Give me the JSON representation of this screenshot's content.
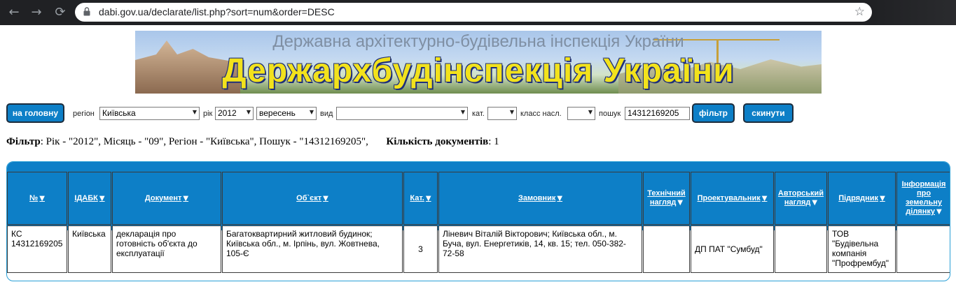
{
  "browser": {
    "url": "dabi.gov.ua/declarate/list.php?sort=num&order=DESC"
  },
  "banner": {
    "subtitle": "Державна архітектурно-будівельна інспекція України",
    "title": "Держархбудінспекція України"
  },
  "filters": {
    "home_label": "на головну",
    "region_label": "регіон",
    "region_value": "Київська",
    "year_label": "рік",
    "year_value": "2012",
    "month_value": "вересень",
    "type_label": "вид",
    "type_value": "",
    "cat_label": "кат.",
    "cat_value": "",
    "class_label": "класс насл.",
    "class_value": "",
    "search_label": "пошук",
    "search_value": "14312169205",
    "filter_button": "фільтр",
    "reset_button": "скинути"
  },
  "summary": {
    "filter_label": "Фільтр",
    "filter_text": ": Рік - \"2012\", Місяць - \"09\", Регіон - \"Київська\", Пошук - \"14312169205\",",
    "count_label": "Кількість документів",
    "count_text": ": 1"
  },
  "table": {
    "headers": [
      "№",
      "ІДАБК",
      "Документ",
      "Об`єкт",
      "Кат.",
      "Замовник",
      "Технічний нагляд",
      "Проектувальник",
      "Авторський нагляд",
      "Підрядник",
      "Інформація про земельну ділянку"
    ],
    "rows": [
      {
        "num": "КС 14312169205",
        "idabk": "Київська",
        "document": "декларація про готовність об'єкта до експлуатації",
        "object": "Багатоквартирний житловий будинок; Київська обл., м. Ірпінь, вул. Жовтнева, 105-Є",
        "cat": "3",
        "customer": "Ліневич Віталій Вікторович; Київська обл., м. Буча, вул. Енергетиків, 14, кв. 15; тел. 050-382-72-58",
        "tech_supervision": "",
        "designer": "ДП ПАТ \"Сумбуд\"",
        "author_supervision": "",
        "contractor": "ТОВ \"Будівельна компанія \"Профрембуд\"",
        "land_info": ""
      }
    ]
  },
  "colors": {
    "accent_blue": "#0d7fc7",
    "banner_title_yellow": "#f2e21c",
    "chrome_dark": "#202124"
  }
}
